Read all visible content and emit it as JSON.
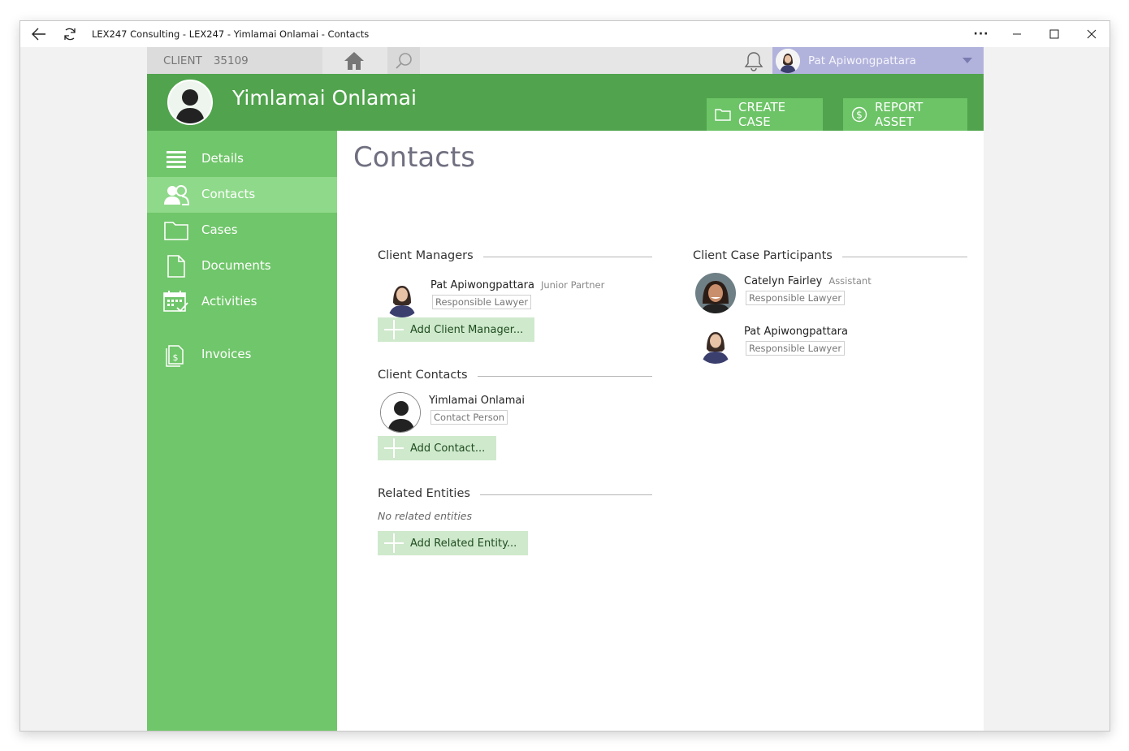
{
  "window": {
    "title": "LEX247 Consulting - LEX247 - Yimlamai Onlamai - Contacts"
  },
  "topbar": {
    "client_label": "CLIENT",
    "client_number": "35109",
    "user_name": "Pat Apiwongpattara"
  },
  "header": {
    "client_name": "Yimlamai Onlamai",
    "create_case_label": "CREATE CASE",
    "report_asset_label": "REPORT ASSET"
  },
  "sidebar": {
    "items": [
      {
        "label": "Details",
        "icon": "list-icon",
        "active": false
      },
      {
        "label": "Contacts",
        "icon": "people-icon",
        "active": true
      },
      {
        "label": "Cases",
        "icon": "folder-icon",
        "active": false
      },
      {
        "label": "Documents",
        "icon": "document-icon",
        "active": false
      },
      {
        "label": "Activities",
        "icon": "calendar-check-icon",
        "active": false
      },
      {
        "label": "Invoices",
        "icon": "invoice-icon",
        "active": false
      }
    ]
  },
  "main": {
    "page_title": "Contacts",
    "client_managers": {
      "heading": "Client Managers",
      "people": [
        {
          "name": "Pat Apiwongpattara",
          "role": "Junior Partner",
          "tag": "Responsible Lawyer"
        }
      ],
      "add_label": "Add Client Manager..."
    },
    "client_contacts": {
      "heading": "Client Contacts",
      "people": [
        {
          "name": "Yimlamai Onlamai",
          "role": "",
          "tag": "Contact Person"
        }
      ],
      "add_label": "Add Contact..."
    },
    "related_entities": {
      "heading": "Related Entities",
      "empty_text": "No related entities",
      "add_label": "Add Related Entity..."
    },
    "case_participants": {
      "heading": "Client Case Participants",
      "people": [
        {
          "name": "Catelyn Fairley",
          "role": "Assistant",
          "tag": "Responsible Lawyer"
        },
        {
          "name": "Pat Apiwongpattara",
          "role": "",
          "tag": "Responsible Lawyer"
        }
      ]
    }
  },
  "colors": {
    "header_green": "#51a44d",
    "sidebar_green": "#70c66a",
    "active_nav": "#8fd98a",
    "user_box": "#b2b3dc",
    "add_button": "#cfe9cc"
  }
}
